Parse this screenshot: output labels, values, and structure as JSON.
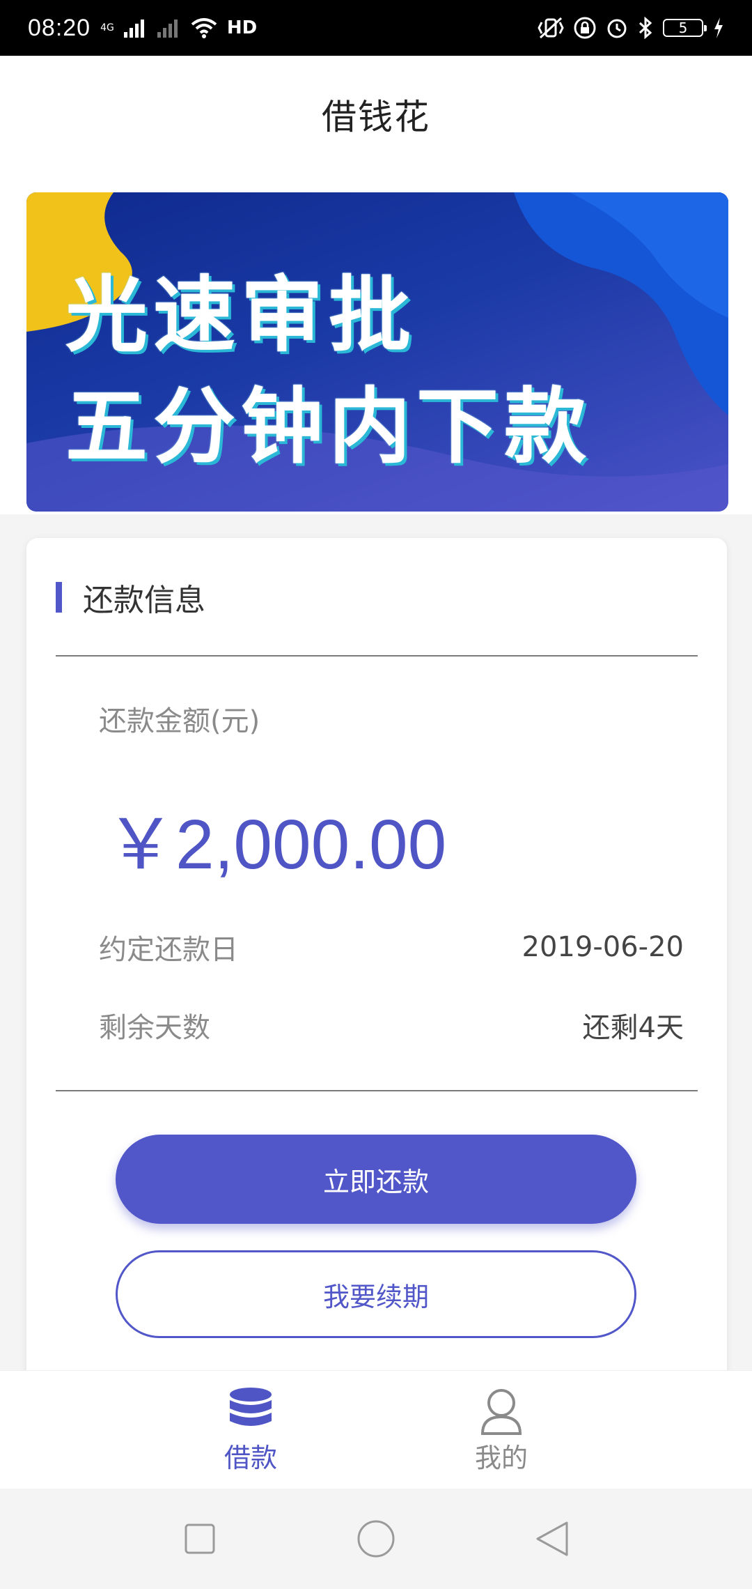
{
  "status_bar": {
    "time": "08:20",
    "network": "4G",
    "hd_label": "HD",
    "battery": "5",
    "icons": [
      "signal-icon",
      "wifi-icon",
      "vibrate-icon",
      "lock-icon",
      "alarm-icon",
      "bluetooth-icon",
      "battery-icon",
      "charging-icon"
    ]
  },
  "header": {
    "title": "借钱花"
  },
  "banner": {
    "line1": "光速审批",
    "line2": "五分钟内下款"
  },
  "repayment": {
    "section_title": "还款信息",
    "amount_label": "还款金额(元)",
    "amount": "￥2,000.00",
    "due_date_label": "约定还款日",
    "due_date": "2019-06-20",
    "remaining_label": "剩余天数",
    "remaining": "还剩4天"
  },
  "actions": {
    "repay_now": "立即还款",
    "renew": "我要续期"
  },
  "tabbar": {
    "items": [
      {
        "label": "借款",
        "icon": "database-icon",
        "active": true
      },
      {
        "label": "我的",
        "icon": "user-icon",
        "active": false
      }
    ]
  },
  "colors": {
    "accent": "#5156c8",
    "text_muted": "#8a8a8a"
  }
}
